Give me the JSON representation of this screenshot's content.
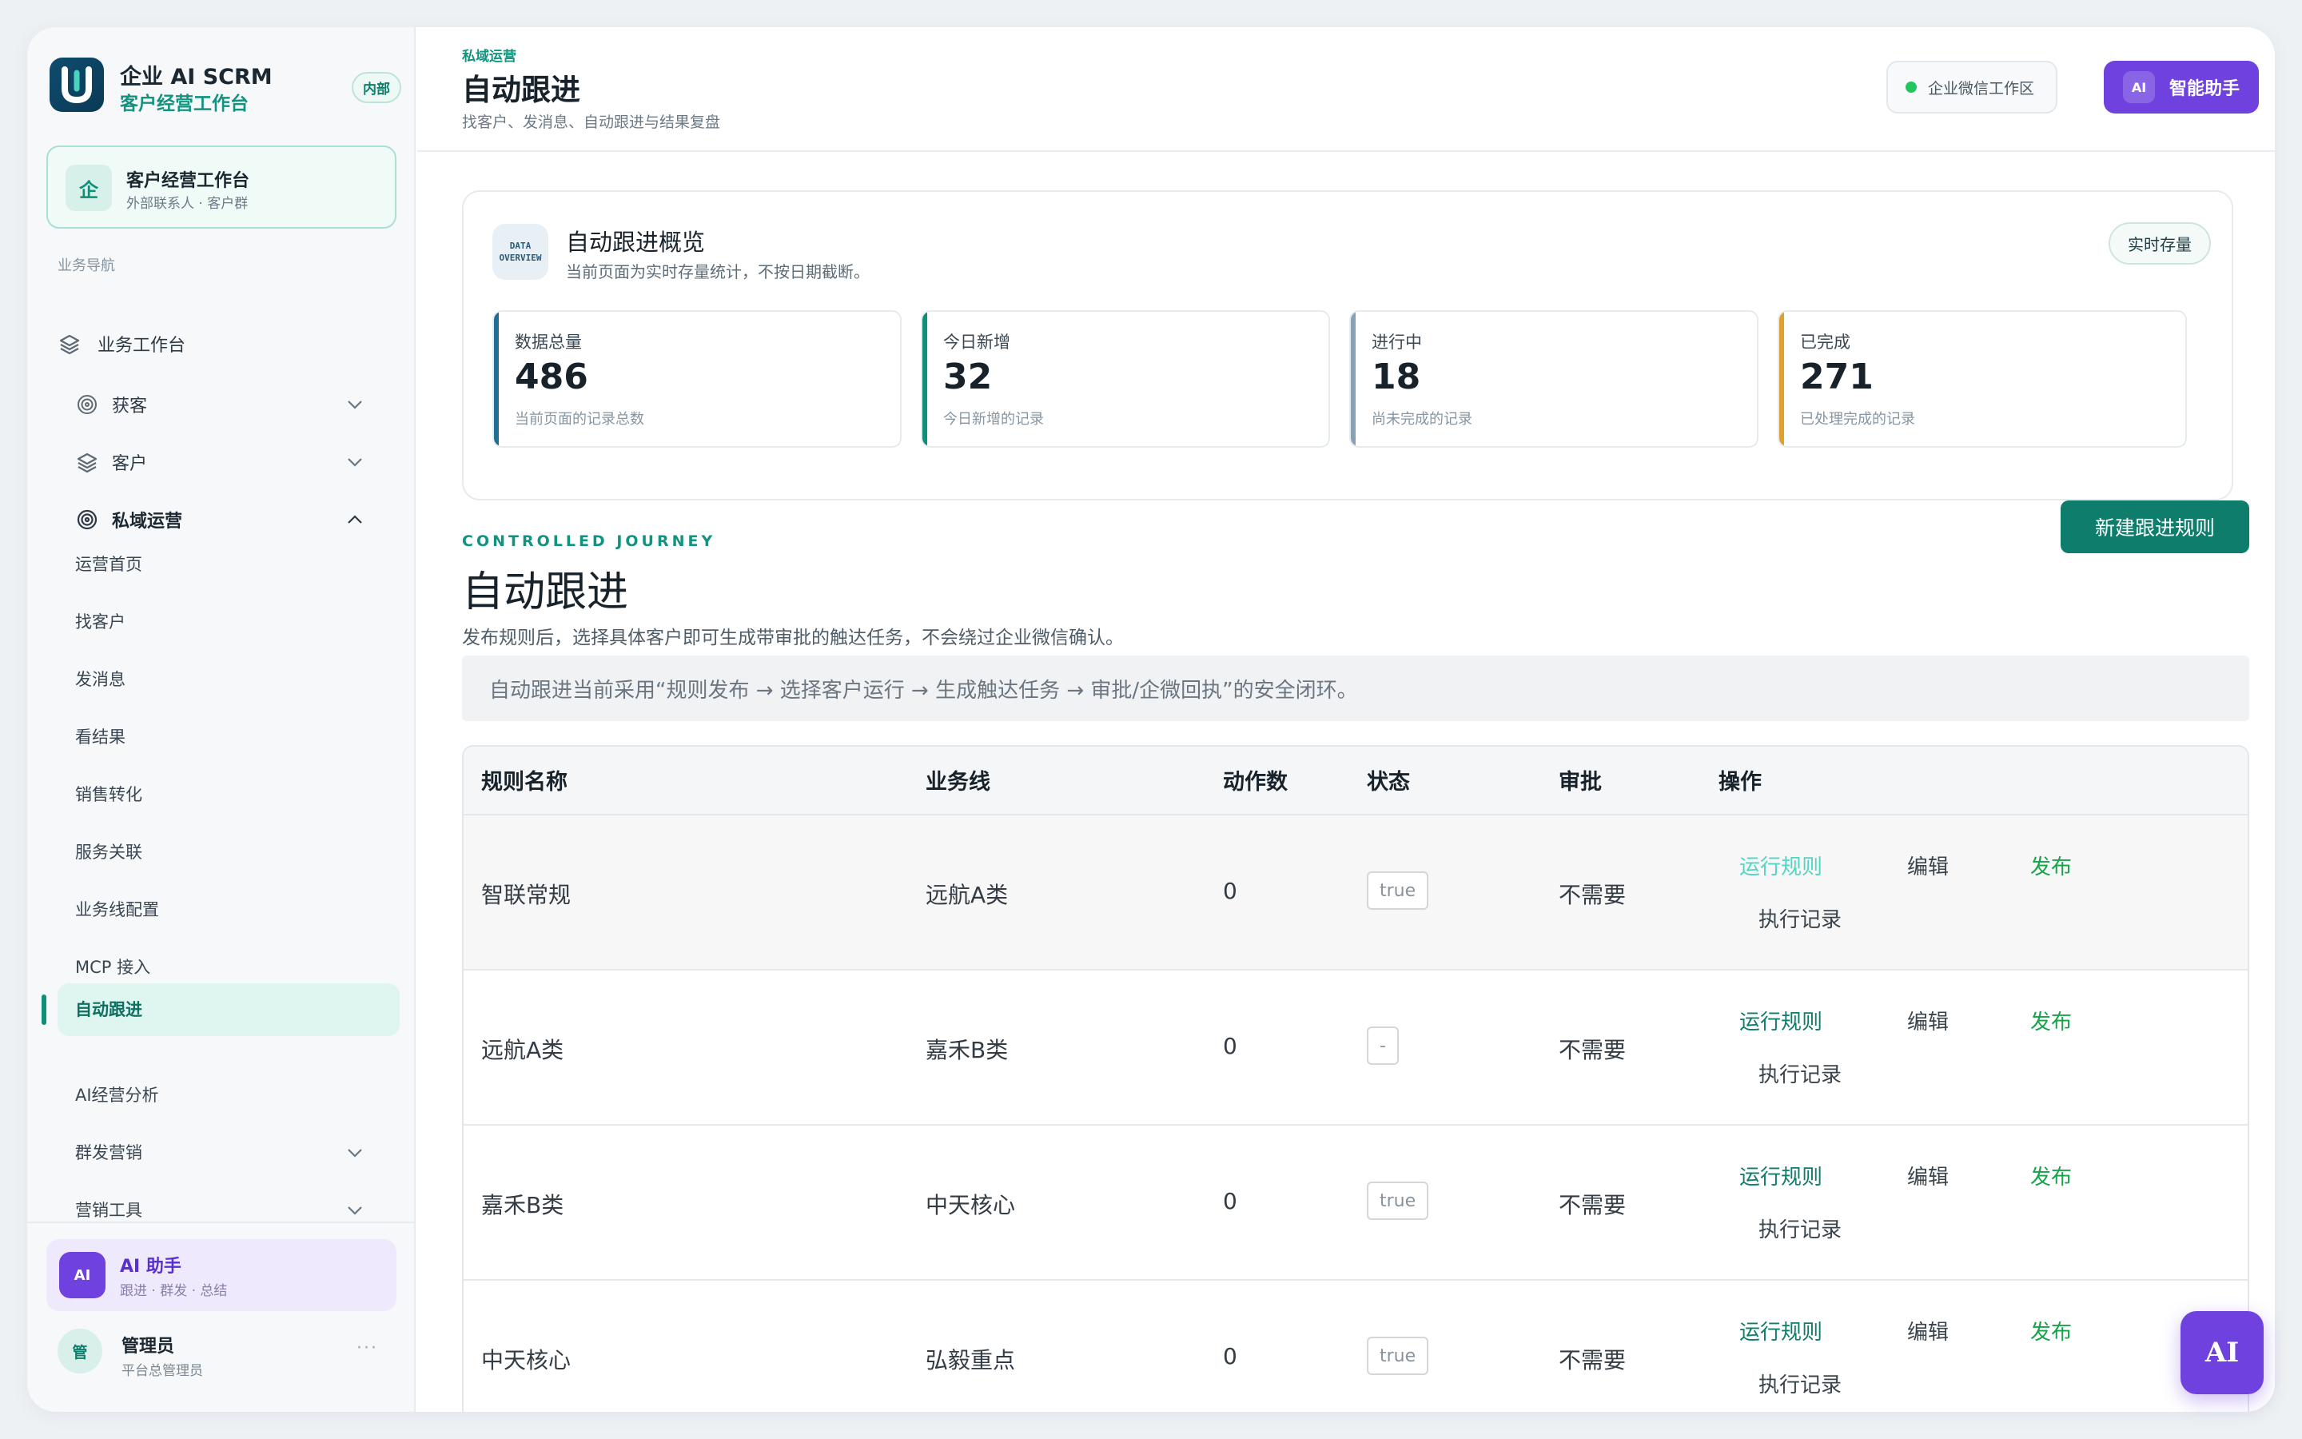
{
  "brand": {
    "name": "企业 AI SCRM",
    "subtitle": "客户经营工作台",
    "badge": "内部",
    "logo_letter": "U"
  },
  "workspace": {
    "icon": "企",
    "title": "客户经营工作台",
    "subtitle": "外部联系人 · 客户群"
  },
  "nav": {
    "section_label": "业务导航",
    "top_item": {
      "label": "业务工作台",
      "icon": "layers-icon"
    },
    "groups": [
      {
        "label": "获客",
        "icon": "target-icon",
        "expanded": false
      },
      {
        "label": "客户",
        "icon": "layers-icon",
        "expanded": false
      },
      {
        "label": "私域运营",
        "icon": "target-icon",
        "expanded": true
      }
    ],
    "leaves": [
      "运营首页",
      "找客户",
      "发消息",
      "看结果",
      "销售转化",
      "服务关联",
      "业务线配置",
      "MCP 接入",
      "自动跟进",
      "AI经营分析"
    ],
    "active": "自动跟进",
    "bottom_groups": [
      {
        "label": "群发营销",
        "expanded": false
      },
      {
        "label": "营销工具",
        "expanded": false
      }
    ]
  },
  "ai_card": {
    "icon": "AI",
    "title": "AI 助手",
    "subtitle": "跟进 · 群发 · 总结"
  },
  "user": {
    "avatar": "管",
    "name": "管理员",
    "role": "平台总管理员",
    "more": "···"
  },
  "header": {
    "breadcrumb": "私域运营",
    "title": "自动跟进",
    "subtitle": "找客户、发消息、自动跟进与结果复盘",
    "env_label": "企业微信工作区",
    "assistant_chip": "AI",
    "assistant_label": "智能助手"
  },
  "overview": {
    "icon_line1": "DATA",
    "icon_line2": "OVERVIEW",
    "title": "自动跟进概览",
    "subtitle": "当前页面为实时存量统计，不按日期截断。",
    "pill": "实时存量",
    "stats": [
      {
        "label": "数据总量",
        "value": "486",
        "desc": "当前页面的记录总数",
        "color": "#1f6f94"
      },
      {
        "label": "今日新增",
        "value": "32",
        "desc": "今日新增的记录",
        "color": "#0e8f78"
      },
      {
        "label": "进行中",
        "value": "18",
        "desc": "尚未完成的记录",
        "color": "#8aa0b5"
      },
      {
        "label": "已完成",
        "value": "271",
        "desc": "已处理完成的记录",
        "color": "#e0a030"
      }
    ]
  },
  "section": {
    "eyebrow": "CONTROLLED JOURNEY",
    "title": "自动跟进",
    "desc": "发布规则后，选择具体客户即可生成带审批的触达任务，不会绕过企业微信确认。",
    "new_button": "新建跟进规则",
    "notice": "自动跟进当前采用“规则发布 → 选择客户运行 → 生成触达任务 → 审批/企微回执”的安全闭环。"
  },
  "table": {
    "headers": [
      "规则名称",
      "业务线",
      "动作数",
      "状态",
      "审批",
      "操作"
    ],
    "actions": {
      "run": "运行规则",
      "edit": "编辑",
      "publish": "发布",
      "log": "执行记录"
    },
    "rows": [
      {
        "name": "智联常规",
        "line": "远航A类",
        "count": "0",
        "status": "true",
        "approval": "不需要"
      },
      {
        "name": "远航A类",
        "line": "嘉禾B类",
        "count": "0",
        "status": "-",
        "approval": "不需要"
      },
      {
        "name": "嘉禾B类",
        "line": "中天核心",
        "count": "0",
        "status": "true",
        "approval": "不需要"
      },
      {
        "name": "中天核心",
        "line": "弘毅重点",
        "count": "0",
        "status": "true",
        "approval": "不需要"
      }
    ]
  },
  "float_button": "AI"
}
